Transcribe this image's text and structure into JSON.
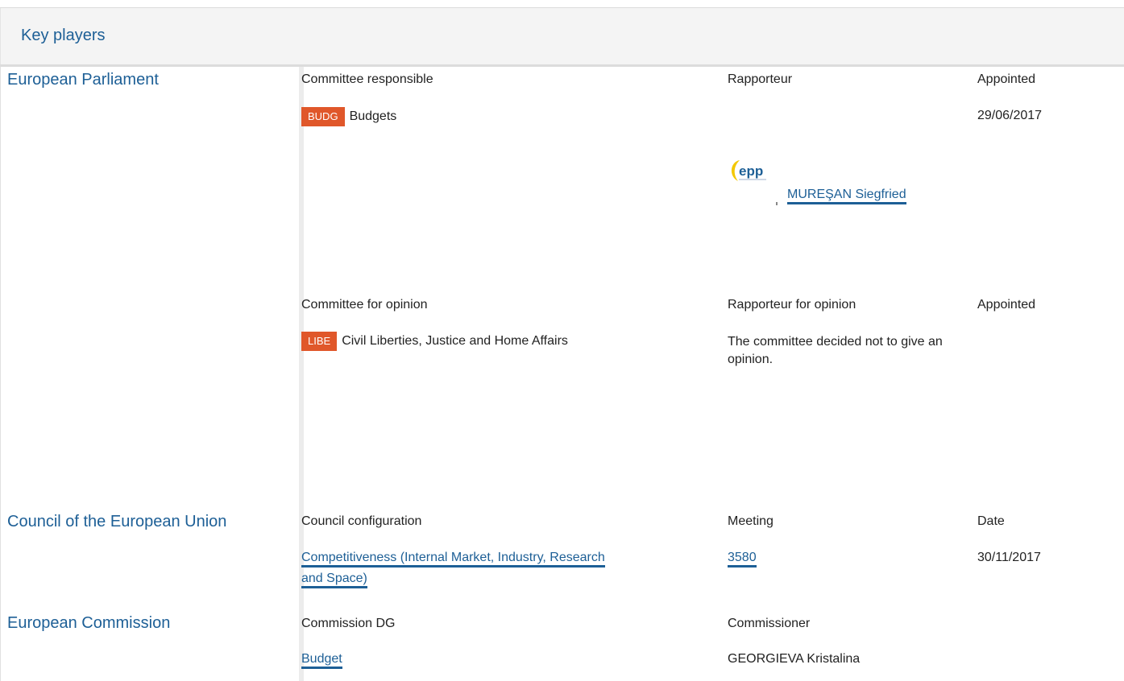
{
  "header": {
    "title": "Key players"
  },
  "parliament": {
    "label": "European Parliament",
    "responsible": {
      "col_committee": "Committee responsible",
      "col_rapporteur": "Rapporteur",
      "col_appointed": "Appointed",
      "badge": "BUDG",
      "committee": "Budgets",
      "appointed": "29/06/2017",
      "rapporteur": "MUREŞAN Siegfried",
      "party_logo_text": "epp"
    },
    "opinion": {
      "col_committee": "Committee for opinion",
      "col_rapporteur": "Rapporteur for opinion",
      "col_appointed": "Appointed",
      "badge": "LIBE",
      "committee": "Civil Liberties, Justice and Home Affairs",
      "rapporteur_text": "The committee decided not to give an opinion."
    }
  },
  "council": {
    "label": "Council of the European Union",
    "col_config": "Council configuration",
    "col_meeting": "Meeting",
    "col_date": "Date",
    "configuration_line1": "Competitiveness (Internal Market, Industry, Research",
    "configuration_line2": "and Space)",
    "meeting": "3580",
    "date": "30/11/2017"
  },
  "commission": {
    "label": "European Commission",
    "col_dg": "Commission DG",
    "col_commissioner": "Commissioner",
    "dg": "Budget",
    "commissioner": "GEORGIEVA Kristalina"
  },
  "colors": {
    "link": "#1d5f96",
    "badge": "#e0572a"
  }
}
